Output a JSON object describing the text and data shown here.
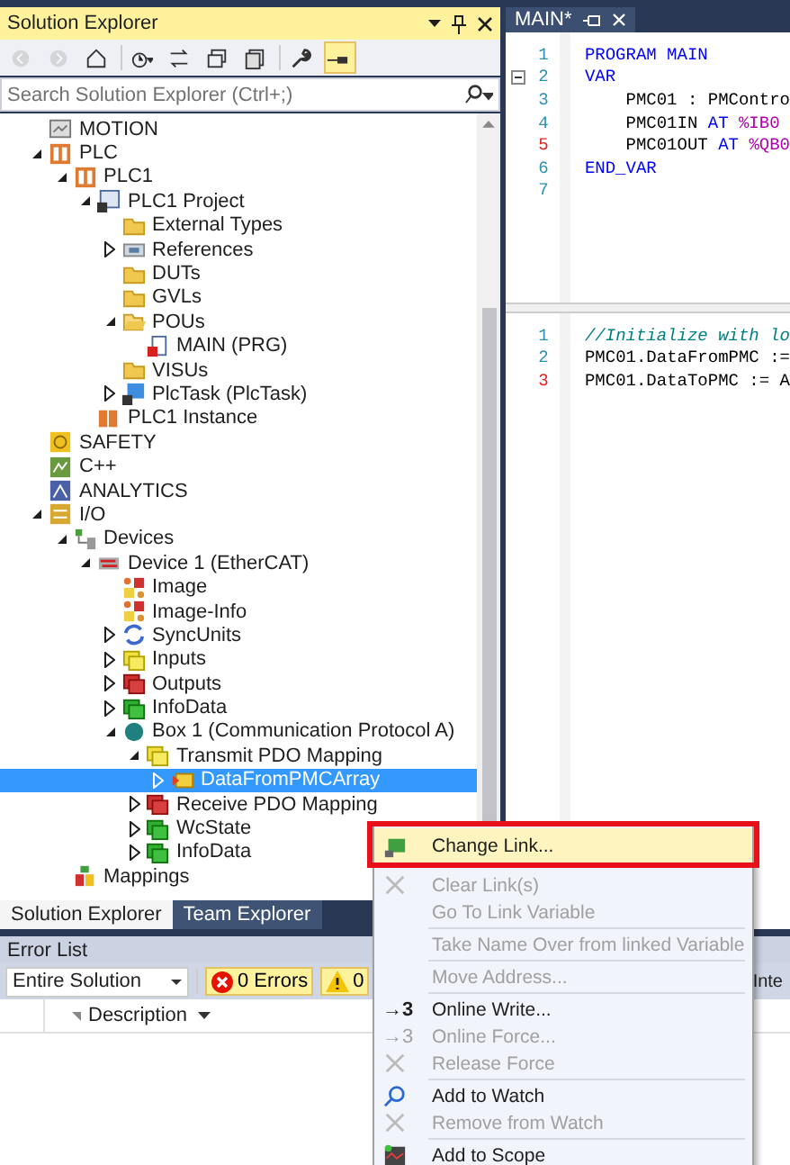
{
  "solution_explorer": {
    "title": "Solution Explorer",
    "toolbar": [
      {
        "kind": "back",
        "disabled": true,
        "on": false
      },
      {
        "kind": "forward",
        "disabled": true,
        "on": false
      },
      {
        "kind": "home",
        "disabled": false,
        "on": false
      },
      {
        "kind": "history",
        "disabled": false,
        "on": false
      },
      {
        "kind": "sync",
        "disabled": false,
        "on": false
      },
      {
        "kind": "collapse",
        "disabled": false,
        "on": false
      },
      {
        "kind": "showall",
        "disabled": false,
        "on": false
      },
      {
        "kind": "properties",
        "disabled": false,
        "on": false
      },
      {
        "kind": "preview",
        "disabled": false,
        "on": true
      }
    ],
    "search": {
      "placeholder": "Search Solution Explorer (Ctrl+;)"
    },
    "tree": [
      {
        "label": "MOTION",
        "kind": "motion",
        "selected": false
      },
      {
        "label": "PLC",
        "kind": "plc",
        "selected": false,
        "expanded": true,
        "children": [
          {
            "label": "PLC1",
            "kind": "plc",
            "selected": false,
            "expanded": true,
            "children": [
              {
                "label": "PLC1 Project",
                "kind": "project",
                "selected": false,
                "expanded": true,
                "children": [
                  {
                    "label": "External Types",
                    "kind": "folder",
                    "selected": false
                  },
                  {
                    "label": "References",
                    "kind": "references",
                    "selected": false,
                    "expanded": false
                  },
                  {
                    "label": "DUTs",
                    "kind": "folder",
                    "selected": false
                  },
                  {
                    "label": "GVLs",
                    "kind": "folder",
                    "selected": false
                  },
                  {
                    "label": "POUs",
                    "kind": "folder-open",
                    "selected": false,
                    "expanded": true,
                    "children": [
                      {
                        "label": "MAIN (PRG)",
                        "kind": "pou",
                        "selected": false
                      }
                    ]
                  },
                  {
                    "label": "VISUs",
                    "kind": "folder",
                    "selected": false
                  },
                  {
                    "label": "PlcTask (PlcTask)",
                    "kind": "task",
                    "selected": false,
                    "expanded": false
                  }
                ]
              },
              {
                "label": "PLC1 Instance",
                "kind": "instance",
                "selected": false
              }
            ]
          }
        ]
      },
      {
        "label": "SAFETY",
        "kind": "safety",
        "selected": false
      },
      {
        "label": "C++",
        "kind": "cpp",
        "selected": false
      },
      {
        "label": "ANALYTICS",
        "kind": "analytics",
        "selected": false
      },
      {
        "label": "I/O",
        "kind": "io",
        "selected": false,
        "expanded": true,
        "children": [
          {
            "label": "Devices",
            "kind": "devices",
            "selected": false,
            "expanded": true,
            "children": [
              {
                "label": "Device 1 (EtherCAT)",
                "kind": "ethercat",
                "selected": false,
                "expanded": true,
                "children": [
                  {
                    "label": "Image",
                    "kind": "image",
                    "selected": false
                  },
                  {
                    "label": "Image-Info",
                    "kind": "image",
                    "selected": false
                  },
                  {
                    "label": "SyncUnits",
                    "kind": "sync",
                    "selected": false,
                    "expanded": false
                  },
                  {
                    "label": "Inputs",
                    "kind": "inputs",
                    "selected": false,
                    "expanded": false
                  },
                  {
                    "label": "Outputs",
                    "kind": "outputs",
                    "selected": false,
                    "expanded": false
                  },
                  {
                    "label": "InfoData",
                    "kind": "infodata",
                    "selected": false,
                    "expanded": false
                  },
                  {
                    "label": "Box 1 (Communication Protocol A)",
                    "kind": "box",
                    "selected": false,
                    "expanded": true,
                    "children": [
                      {
                        "label": "Transmit PDO Mapping",
                        "kind": "inputs",
                        "selected": false,
                        "expanded": true,
                        "children": [
                          {
                            "label": "DataFromPMCArray",
                            "kind": "variable",
                            "selected": true,
                            "expanded": false
                          }
                        ]
                      },
                      {
                        "label": "Receive PDO Mapping",
                        "kind": "outputs",
                        "selected": false,
                        "expanded": false
                      },
                      {
                        "label": "WcState",
                        "kind": "infodata",
                        "selected": false,
                        "expanded": false
                      },
                      {
                        "label": "InfoData",
                        "kind": "infodata",
                        "selected": false,
                        "expanded": false
                      }
                    ]
                  }
                ]
              }
            ]
          },
          {
            "label": "Mappings",
            "kind": "mappings",
            "selected": false
          }
        ]
      }
    ],
    "tabs": [
      {
        "label": "Solution Explorer",
        "selected": true
      },
      {
        "label": "Team Explorer",
        "selected": false
      }
    ]
  },
  "editor": {
    "tab": "MAIN*",
    "declaration": [
      {
        "number": "1",
        "changed": false,
        "foldable": false,
        "tokens": [
          {
            "text": "PROGRAM MAIN",
            "kind": "keyword"
          }
        ]
      },
      {
        "number": "2",
        "changed": false,
        "foldable": true,
        "tokens": [
          {
            "text": "VAR",
            "kind": "keyword"
          }
        ]
      },
      {
        "number": "3",
        "changed": false,
        "foldable": false,
        "tokens": [
          {
            "text": "    PMC01 : PMContro",
            "kind": "plain"
          }
        ]
      },
      {
        "number": "4",
        "changed": false,
        "foldable": false,
        "tokens": [
          {
            "text": "    PMC01IN ",
            "kind": "plain"
          },
          {
            "text": "AT ",
            "kind": "keyword"
          },
          {
            "text": "%IB0",
            "kind": "address"
          }
        ]
      },
      {
        "number": "5",
        "changed": true,
        "foldable": false,
        "tokens": [
          {
            "text": "    PMC01OUT ",
            "kind": "plain"
          },
          {
            "text": "AT ",
            "kind": "keyword"
          },
          {
            "text": "%QB0",
            "kind": "address"
          }
        ]
      },
      {
        "number": "6",
        "changed": false,
        "foldable": false,
        "tokens": [
          {
            "text": "END_VAR",
            "kind": "keyword"
          }
        ]
      },
      {
        "number": "7",
        "changed": false,
        "foldable": false
      }
    ],
    "implementation": [
      {
        "number": "1",
        "changed": false,
        "tokens": [
          {
            "text": "//Initialize with lo",
            "kind": "comment"
          }
        ]
      },
      {
        "number": "2",
        "changed": false,
        "tokens": [
          {
            "text": "PMC01.DataFromPMC :=",
            "kind": "plain"
          }
        ]
      },
      {
        "number": "3",
        "changed": true,
        "tokens": [
          {
            "text": "PMC01.DataToPMC := A",
            "kind": "plain"
          }
        ]
      }
    ]
  },
  "error_list": {
    "title": "Error List",
    "scope": "Entire Solution",
    "errors": {
      "label": "0 Errors",
      "on": true
    },
    "warnings": {
      "label": "0",
      "on": true
    },
    "cut_text": "Inte",
    "columns": [
      "Description"
    ]
  },
  "context_menu": {
    "groups": [
      [
        {
          "label": "Change Link...",
          "kind": "link",
          "disabled": false,
          "selected": true
        },
        {
          "label": "Clear Link(s)",
          "kind": "clear",
          "disabled": true,
          "selected": false
        },
        {
          "label": "Go To Link Variable",
          "kind": "none",
          "disabled": true,
          "selected": false
        }
      ],
      [
        {
          "label": "Take Name Over from linked Variable",
          "kind": "none",
          "disabled": true,
          "selected": false
        }
      ],
      [
        {
          "label": "Move Address...",
          "kind": "none",
          "disabled": true,
          "selected": false
        }
      ],
      [
        {
          "label": "Online Write...",
          "kind": "glyph",
          "glyph": "→3",
          "disabled": false,
          "selected": false
        },
        {
          "label": "Online Force...",
          "kind": "glyph",
          "glyph": "→3",
          "disabled": true,
          "selected": false
        },
        {
          "label": "Release Force",
          "kind": "clear",
          "disabled": true,
          "selected": false
        }
      ],
      [
        {
          "label": "Add to Watch",
          "kind": "watch",
          "disabled": false,
          "selected": false
        },
        {
          "label": "Remove from Watch",
          "kind": "clear",
          "disabled": true,
          "selected": false
        }
      ],
      [
        {
          "label": "Add to Scope",
          "kind": "scope",
          "disabled": false,
          "selected": false
        }
      ]
    ]
  }
}
